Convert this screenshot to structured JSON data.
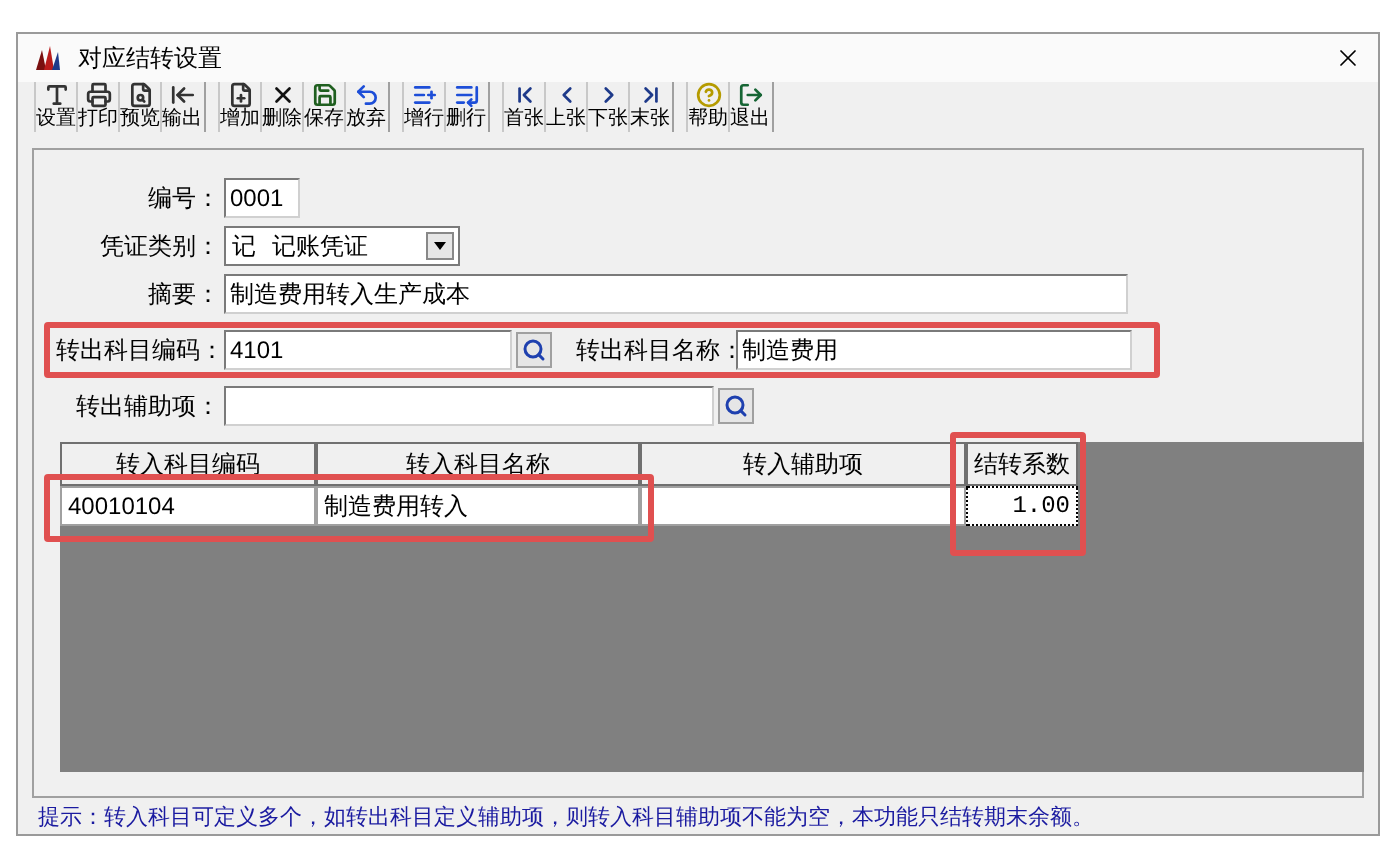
{
  "window": {
    "title": "对应结转设置"
  },
  "toolbar": [
    {
      "buttons": [
        {
          "label": "设置"
        },
        {
          "label": "打印"
        },
        {
          "label": "预览"
        },
        {
          "label": "输出"
        }
      ]
    },
    {
      "buttons": [
        {
          "label": "增加"
        },
        {
          "label": "删除"
        },
        {
          "label": "保存"
        },
        {
          "label": "放弃"
        }
      ]
    },
    {
      "buttons": [
        {
          "label": "增行"
        },
        {
          "label": "删行"
        }
      ]
    },
    {
      "buttons": [
        {
          "label": "首张"
        },
        {
          "label": "上张"
        },
        {
          "label": "下张"
        },
        {
          "label": "末张"
        }
      ]
    },
    {
      "buttons": [
        {
          "label": "帮助"
        },
        {
          "label": "退出"
        }
      ]
    }
  ],
  "form": {
    "number": {
      "label": "编号：",
      "value": "0001"
    },
    "voucher_type": {
      "label": "凭证类别：",
      "code": "记",
      "name": "记账凭证"
    },
    "summary": {
      "label": "摘要：",
      "value": "制造费用转入生产成本"
    },
    "out_code": {
      "label": "转出科目编码：",
      "value": "4101"
    },
    "out_name": {
      "label": "转出科目名称：",
      "value": "制造费用"
    },
    "out_aux": {
      "label": "转出辅助项："
    }
  },
  "table": {
    "columns": [
      "转入科目编码",
      "转入科目名称",
      "转入辅助项",
      "结转系数"
    ],
    "rows": [
      {
        "code": "40010104",
        "name": "制造费用转入",
        "coefficient": "1.00"
      }
    ]
  },
  "status_bar": "提示：转入科目可定义多个，如转出科目定义辅助项，则转入科目辅助项不能为空，本功能只结转期末余额。"
}
